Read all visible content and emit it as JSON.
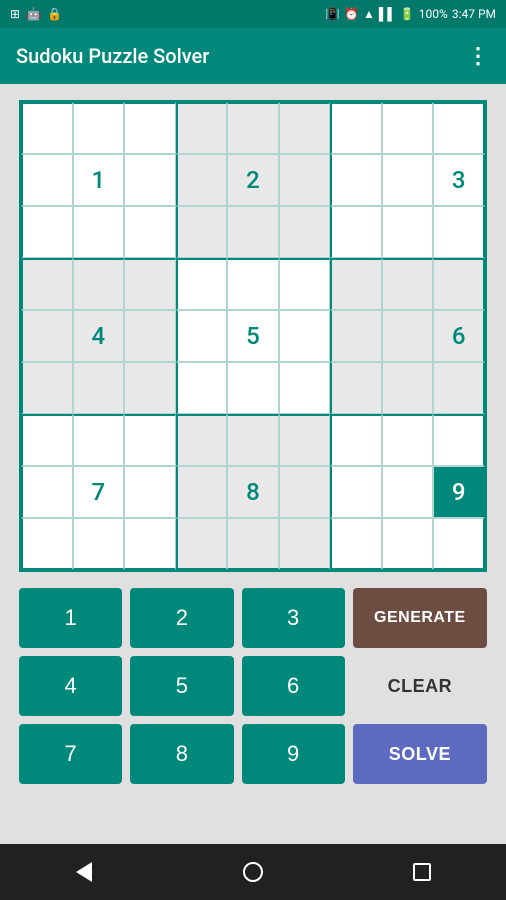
{
  "statusBar": {
    "time": "3:47 PM",
    "battery": "100%"
  },
  "appBar": {
    "title": "Sudoku Puzzle Solver",
    "overflowMenu": "⋮"
  },
  "grid": {
    "cells": [
      [
        "",
        "",
        "",
        "",
        "",
        "",
        "",
        "",
        ""
      ],
      [
        "",
        "1",
        "",
        "",
        "2",
        "",
        "",
        "",
        "3"
      ],
      [
        "",
        "",
        "",
        "",
        "",
        "",
        "",
        "",
        ""
      ],
      [
        "",
        "",
        "",
        "",
        "",
        "",
        "",
        "",
        ""
      ],
      [
        "",
        "4",
        "",
        "",
        "5",
        "",
        "",
        "",
        "6"
      ],
      [
        "",
        "",
        "",
        "",
        "",
        "",
        "",
        "",
        ""
      ],
      [
        "",
        "",
        "",
        "",
        "",
        "",
        "",
        "",
        ""
      ],
      [
        "",
        "7",
        "",
        "",
        "8",
        "",
        "",
        "",
        "9"
      ],
      [
        "",
        "",
        "",
        "",
        "",
        "",
        "",
        "",
        ""
      ]
    ],
    "selectedCell": [
      7,
      8
    ]
  },
  "keypad": {
    "digits": [
      "1",
      "2",
      "3",
      "4",
      "5",
      "6",
      "7",
      "8",
      "9"
    ],
    "generateLabel": "GENERATE",
    "clearLabel": "CLEAR",
    "solveLabel": "SOLVE"
  }
}
